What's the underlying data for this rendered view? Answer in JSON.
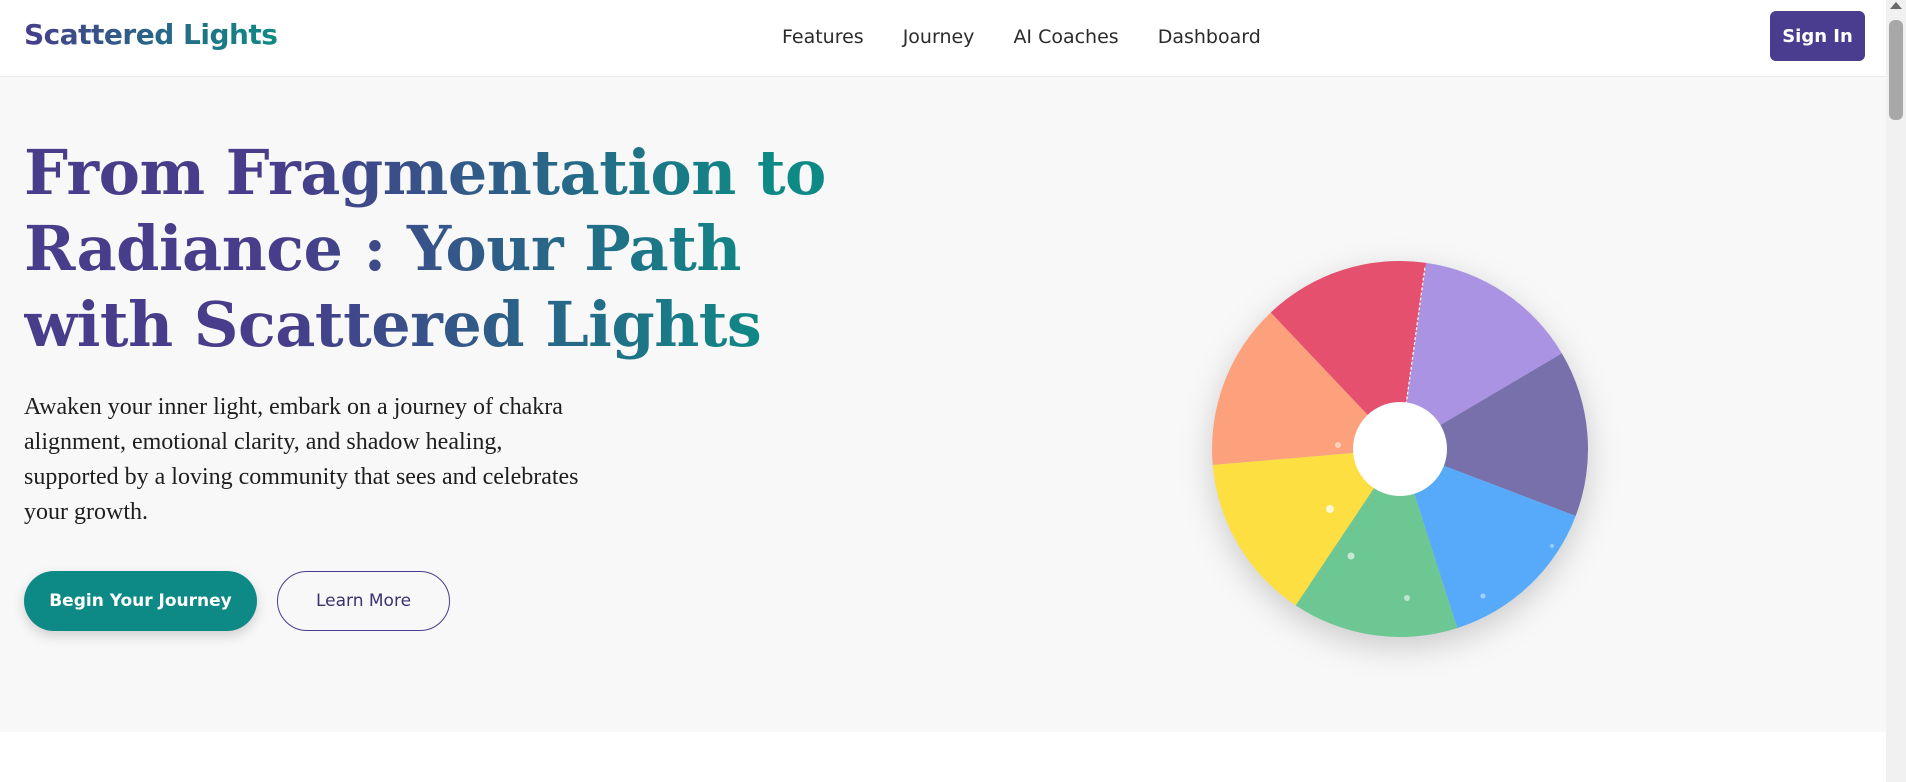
{
  "header": {
    "brand": "Scattered Lights",
    "nav": [
      "Features",
      "Journey",
      "AI Coaches",
      "Dashboard"
    ],
    "signin_label": "Sign In"
  },
  "hero": {
    "title": "From Fragmentation to Radiance : Your Path with Scattered Lights",
    "description": "Awaken your inner light, embark on a journey of chakra alignment, emotional clarity, and shadow healing, supported by a loving community that sees and celebrates your growth.",
    "primary_button": "Begin Your Journey",
    "secondary_button": "Learn More"
  },
  "chakra_wheel": {
    "segments": [
      {
        "name": "lavender",
        "color": "#aa93e2"
      },
      {
        "name": "indigo",
        "color": "#7870ab"
      },
      {
        "name": "blue",
        "color": "#56aaf9"
      },
      {
        "name": "green",
        "color": "#6dc793"
      },
      {
        "name": "yellow",
        "color": "#fedf42"
      },
      {
        "name": "orange",
        "color": "#fda17d"
      },
      {
        "name": "red",
        "color": "#e4506d"
      }
    ]
  },
  "colors": {
    "brand_purple": "#4a3d8f",
    "brand_teal": "#0e8a86",
    "hero_background": "#f8f8f8"
  }
}
